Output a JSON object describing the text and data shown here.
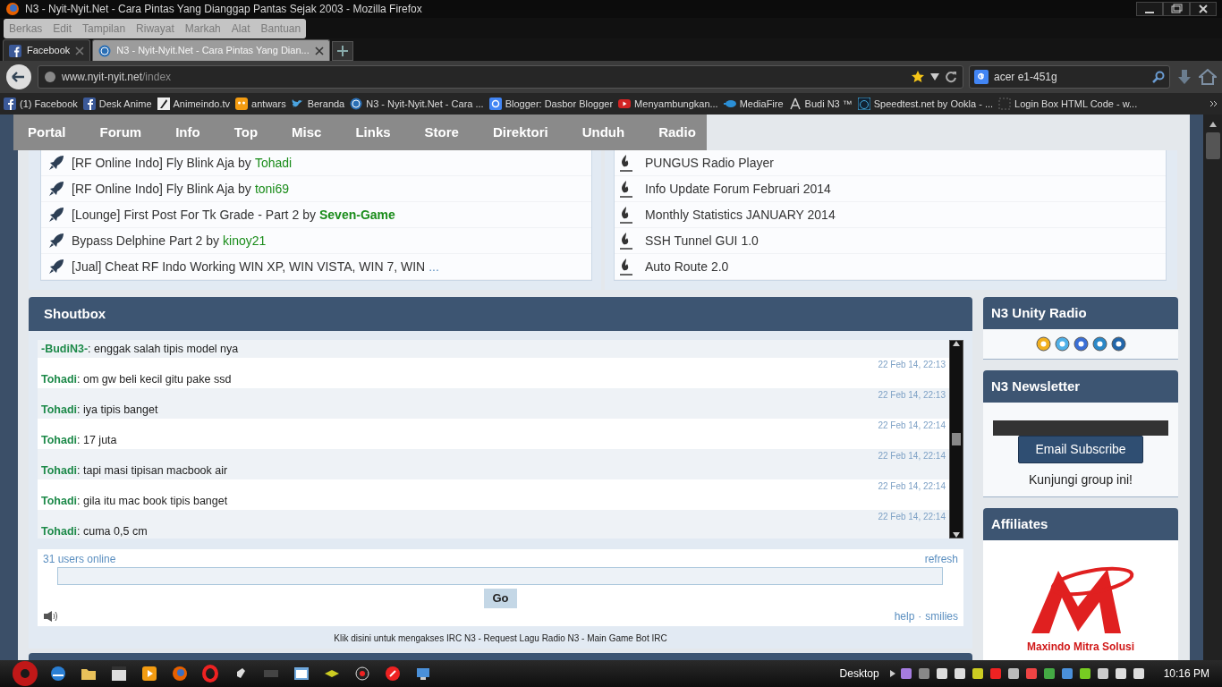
{
  "browser": {
    "title": "N3 - Nyit-Nyit.Net - Cara Pintas Yang Dianggap Pantas Sejak 2003 - Mozilla Firefox",
    "menu": [
      "Berkas",
      "Edit",
      "Tampilan",
      "Riwayat",
      "Markah",
      "Alat",
      "Bantuan"
    ],
    "tabs": [
      {
        "label": "Facebook",
        "selected": false
      },
      {
        "label": "N3 - Nyit-Nyit.Net - Cara Pintas Yang Dian...",
        "selected": true
      }
    ],
    "url_domain": "www.nyit-nyit.net",
    "url_path": "/index",
    "search": "acer e1-451g",
    "bookmarks": [
      "(1) Facebook",
      "Desk Anime",
      "Animeindo.tv",
      "antwars",
      "Beranda",
      "N3 - Nyit-Nyit.Net - Cara ...",
      "Blogger: Dasbor Blogger",
      "Menyambungkan...",
      "MediaFire",
      "Budi N3 ™",
      "Speedtest.net by Ookla - ...",
      "Login Box HTML Code - w..."
    ]
  },
  "nav_menu": [
    "Portal",
    "Forum",
    "Info",
    "Top",
    "Misc",
    "Links",
    "Store",
    "Direktori",
    "Unduh",
    "Radio"
  ],
  "topics": [
    {
      "title": "[RF Online Indo] Fly Blink Aja",
      "by": "by",
      "author": "Tohadi",
      "bold": false
    },
    {
      "title": "[RF Online Indo] Fly Blink Aja",
      "by": "by",
      "author": "toni69",
      "bold": false
    },
    {
      "title": "[Lounge] First Post For Tk Grade - Part 2",
      "by": "by",
      "author": "Seven-Game",
      "bold": true
    },
    {
      "title": "Bypass Delphine Part 2",
      "by": "by",
      "author": "kinoy21",
      "bold": false
    },
    {
      "title": "[Jual] Cheat RF Indo Working WIN XP, WIN VISTA, WIN 7, WIN",
      "more": "..."
    }
  ],
  "news": [
    "PUNGUS Radio Player",
    "Info Update Forum Februari 2014",
    "Monthly Statistics JANUARY 2014",
    "SSH Tunnel GUI 1.0",
    "Auto Route 2.0"
  ],
  "shoutbox": {
    "title": "Shoutbox",
    "messages": [
      {
        "user": "-BudiN3-",
        "text": ": enggak salah tipis model nya"
      },
      {
        "time": "22 Feb 14, 22:13",
        "user": "Tohadi",
        "text": ": om gw beli kecil gitu pake ssd"
      },
      {
        "time": "22 Feb 14, 22:13",
        "user": "Tohadi",
        "text": ": iya tipis banget"
      },
      {
        "time": "22 Feb 14, 22:14",
        "user": "Tohadi",
        "text": ": 17 juta"
      },
      {
        "time": "22 Feb 14, 22:14",
        "user": "Tohadi",
        "text": ": tapi masi tipisan macbook air"
      },
      {
        "time": "22 Feb 14, 22:14",
        "user": "Tohadi",
        "text": ": gila itu mac book tipis banget"
      },
      {
        "time": "22 Feb 14, 22:14",
        "user": "Tohadi",
        "text": ": cuma 0,5 cm"
      }
    ],
    "online": "31 users online",
    "refresh": "refresh",
    "go": "Go",
    "help": "help",
    "separator": "·",
    "smilies": "smilies"
  },
  "irc_note": "Klik disini untuk mengakses IRC N3 - Request Lagu Radio N3 - Main Game Bot IRC",
  "sidebar": {
    "radio_title": "N3 Unity Radio",
    "newsletter_title": "N3 Newsletter",
    "subscribe": "Email Subscribe",
    "group_link": "Kunjungi group ini!",
    "affiliates_title": "Affiliates",
    "affiliate_caption": "Maxindo Mitra Solusi"
  },
  "taskbar": {
    "desktop": "Desktop",
    "clock": "10:16 PM"
  }
}
